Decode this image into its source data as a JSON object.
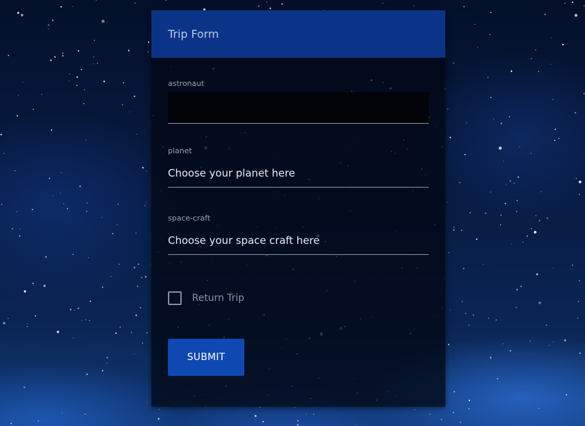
{
  "form": {
    "title": "Trip Form",
    "fields": {
      "astronaut": {
        "label": "astronaut",
        "value": "",
        "placeholder": ""
      },
      "planet": {
        "label": "planet",
        "value": "Choose your planet here"
      },
      "spacecraft": {
        "label": "space-craft",
        "value": "Choose your space craft here"
      }
    },
    "return_trip": {
      "label": "Return Trip",
      "checked": false
    },
    "submit_label": "SUBMIT"
  },
  "colors": {
    "header": "#0b3488",
    "button": "#0f48b0",
    "background": "#071a40"
  }
}
